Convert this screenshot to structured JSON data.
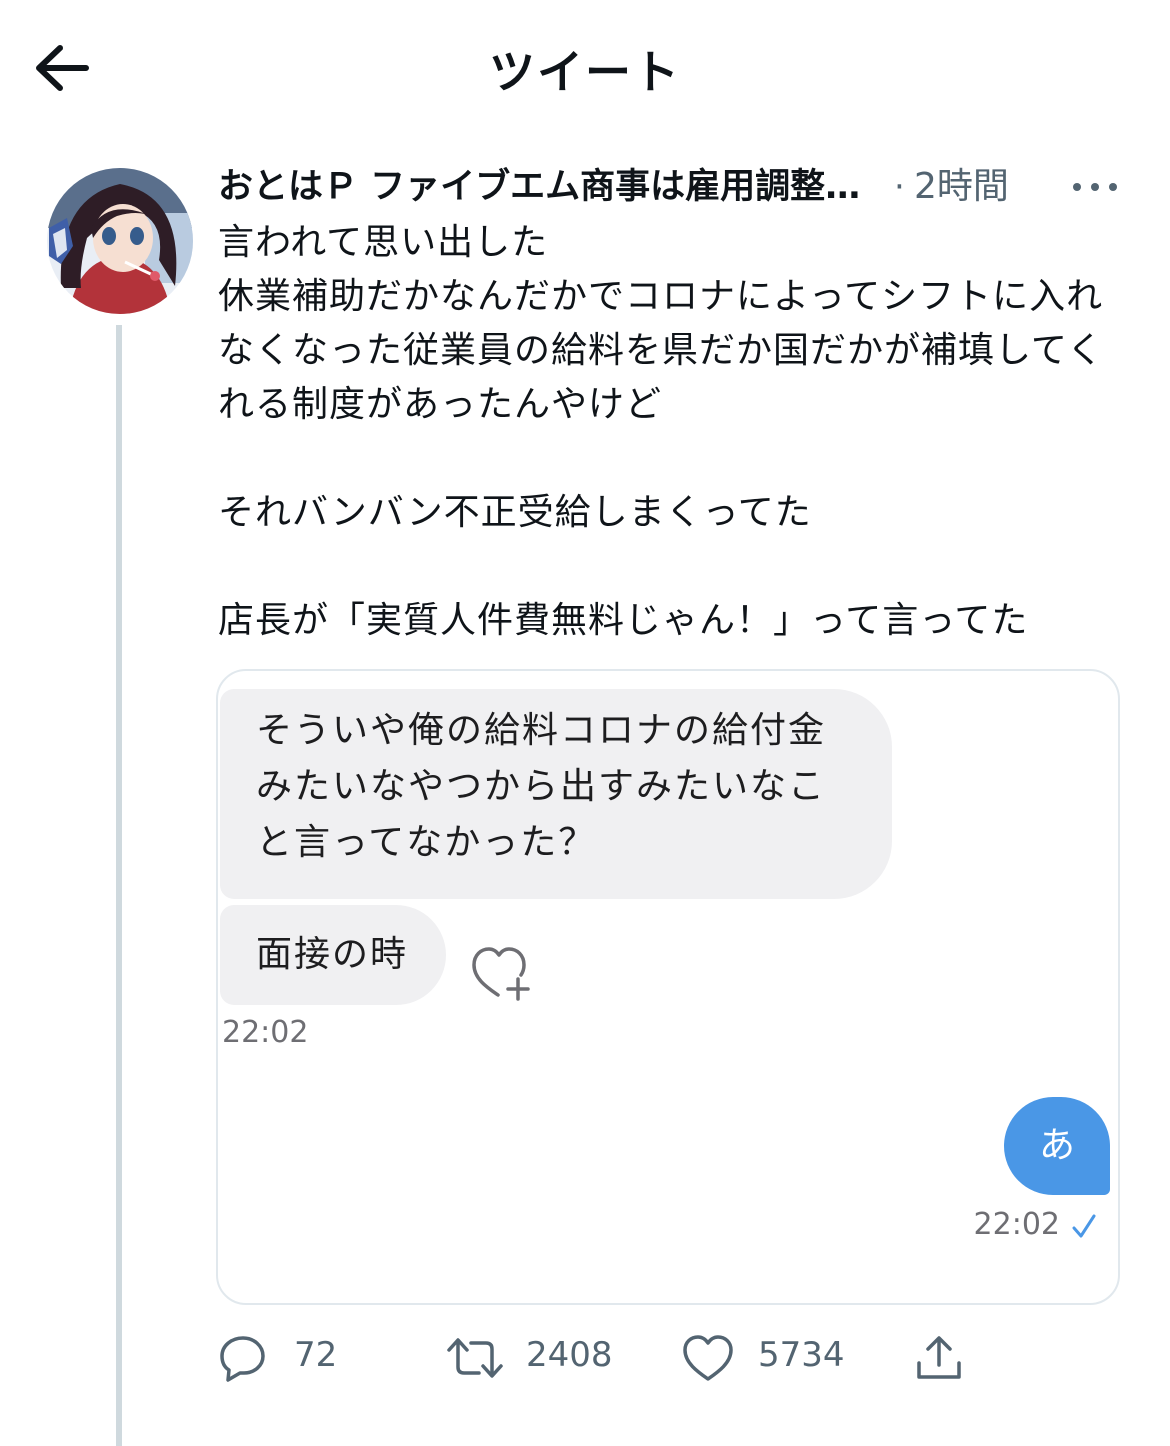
{
  "header": {
    "title": "ツイート"
  },
  "tweet": {
    "author_name": "おとはＰ ファイブエム商事は雇用調整助成金受給",
    "separator": "·",
    "timestamp": "2時間",
    "text": "言われて思い出した\n休業補助だかなんだかでコロナによってシフトに入れなくなった従業員の給料を県だか国だかが補填してくれる制度があったんやけど\n\nそれバンバン不正受給しまくってた\n\n店長が「実質人件費無料じゃん！」って言ってた"
  },
  "media": {
    "messages": [
      {
        "from": "other",
        "text": "そういや俺の給料コロナの給付金みたいなやつから出すみたいなこと言ってなかった？"
      },
      {
        "from": "other",
        "text": "面接の時"
      },
      {
        "from": "me",
        "text": "あ"
      }
    ],
    "time_other": "22:02",
    "time_me": "22:02"
  },
  "actions": {
    "replies": "72",
    "retweets": "2408",
    "likes": "5734"
  },
  "colors": {
    "accent": "#4a97e6",
    "thread_line": "#cfd9de",
    "muted_text": "#536471",
    "bubble_gray": "#f0f0f2"
  }
}
